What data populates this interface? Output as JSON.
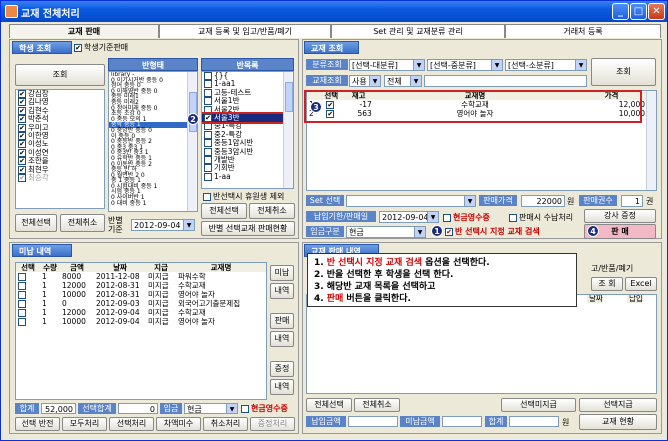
{
  "window": {
    "title": "교재 전체처리",
    "min": "_",
    "max": "□",
    "close": "✕"
  },
  "tabs": [
    {
      "label": "교재 판매",
      "active": true
    },
    {
      "label": "교재 등록 및 입고/반품/폐기"
    },
    {
      "label": "Set 관리 및 교재분류 관리"
    },
    {
      "label": "거래처 등록"
    }
  ],
  "student": {
    "header": "학생 조회",
    "base_label": "학생기준판매",
    "search_button": "조회",
    "names": [
      "강심장",
      "김나영",
      "김현수",
      "박준석",
      "우미고",
      "이한영",
      "이성노",
      "이성연",
      "조한을",
      "최현우",
      "최승각"
    ],
    "all_select": "전체선택",
    "all_cancel": "전체취소",
    "class_label1": "반별",
    "class_label2": "기준",
    "date": "2012-09-04"
  },
  "class_form": {
    "header": "반형태",
    "items": [
      "library -",
      "0 이기시거반 중등 0",
      "정어 중등 0",
      "0 이해영반 중등 0",
      "중등 미래1",
      "중등 미래2",
      "0 정어미래 중등 0",
      "초등 조강 0",
      "0 중등 모의 1",
      "중학 중등 1",
      "0 중앙반 중등 0",
      "이 중등 0",
      "0 중등반 중등 2",
      "0 중3 중3 1",
      "0 중3반 중3 1",
      "0 유학반 중등 1",
      "0 이동반 중등 2",
      "중등 반 하",
      "0 월면반 2 0",
      "중 1 중등 1",
      "0 시험대비 중등 1",
      "시험 중등 1",
      "0 사이버반 1",
      "0 대비 중등 1"
    ],
    "selected_index": 9
  },
  "class_list": {
    "header": "반목록",
    "items": [
      "{}{",
      "1-aa1",
      "고등-테스트",
      "서울1반",
      "서울2반",
      "서울3반",
      "중1-특강",
      "중2-특강",
      "중등1암시반",
      "중등3암시반",
      "개발반",
      "기회반",
      "1-aa"
    ],
    "selected_index": 5,
    "checked_index": 5,
    "rest_label": "반선택시 휴원생 제외",
    "all_select": "전체선택",
    "all_cancel": "전체취소",
    "status_button": "반별 선택교재 판매현황"
  },
  "material": {
    "header": "교재 조회",
    "category_label": "분류조회",
    "cat1": "[선택-대분류]",
    "cat2": "[선택-중분류]",
    "cat3": "[선택-소분류]",
    "search_label": "교재조회",
    "use_filter": "사용",
    "scope": "전체",
    "search_button": "조회",
    "columns": [
      "선택",
      "재고",
      "교재명",
      "가격"
    ],
    "rows": [
      {
        "no": "1",
        "checked": true,
        "stock": "-17",
        "name": "수학교재",
        "price": "12,000"
      },
      {
        "no": "2",
        "checked": true,
        "stock": "563",
        "name": "영어야 놀자",
        "price": "10,000"
      }
    ],
    "set_label": "Set 선택",
    "sale_price_label": "판매가격",
    "sale_price": "22000",
    "won": "원",
    "count_label": "판매권수",
    "count": "1",
    "count_unit": "권",
    "pay_date_label": "납입기한/판매일",
    "pay_date": "2012-09-04",
    "cash_receipt": "현금영수증",
    "unpaid_process": "판매시 수납처리",
    "lecture_gift": "강사 증정",
    "pay_type_label": "입금구분",
    "pay_type": "현금",
    "auto_check": "반 선택시 지정 교재 검색",
    "sell_button": "판 매"
  },
  "unpaid": {
    "header": "미납 내역",
    "columns": [
      "선택",
      "수량",
      "금액",
      "날짜",
      "지급",
      "교재명"
    ],
    "rows": [
      {
        "qty": "1",
        "amount": "8000",
        "date": "2011-12-08",
        "pay": "미지급",
        "name": "파워수학"
      },
      {
        "qty": "1",
        "amount": "12000",
        "date": "2012-08-31",
        "pay": "미지급",
        "name": "수학교재"
      },
      {
        "qty": "1",
        "amount": "10000",
        "date": "2012-08-31",
        "pay": "미지급",
        "name": "영어야 놀자"
      },
      {
        "qty": "1",
        "amount": "0",
        "date": "2012-09-03",
        "pay": "미지급",
        "name": "외국어고기출문제집"
      },
      {
        "qty": "1",
        "amount": "12000",
        "date": "2012-09-04",
        "pay": "미지급",
        "name": "수학교재"
      },
      {
        "qty": "1",
        "amount": "10000",
        "date": "2012-09-04",
        "pay": "미지급",
        "name": "영어야 놀자"
      }
    ],
    "side_buttons": [
      "미납",
      "내역",
      "판매",
      "내역",
      "증정",
      "내역"
    ],
    "total_label": "합계",
    "total": "52,000",
    "sel_total_label": "선택합계",
    "sel_total": "0",
    "deposit_label": "입금",
    "deposit_type": "현금",
    "cash_receipt": "현금영수증",
    "buttons": [
      "선택 반전",
      "모두처리",
      "선택처리",
      "차액미수",
      "취소처리",
      "증정처리"
    ]
  },
  "right_bottom": {
    "header": "교재 판매 내역",
    "tab_label": "고/반품/폐기",
    "search_button": "조 회",
    "excel_button": "Excel",
    "col_date": "날짜",
    "col_pay": "납입",
    "all_select": "전체선택",
    "all_cancel": "전체취소",
    "unpaid_button": "선택미지급",
    "pay_button": "선택지급",
    "pay_amount_label": "납입금액",
    "unpaid_amount_label": "미납금액",
    "sum_label": "합계",
    "won": "원",
    "status_button": "교재 현황"
  },
  "callout": {
    "lines": [
      {
        "num": "1.",
        "red": "반 선택시 지정 교재 검색",
        "rest": " 옵션을 선택한다."
      },
      {
        "num": "2.",
        "red": "",
        "rest": "반을 선택한 후 학생을 선택 한다."
      },
      {
        "num": "3.",
        "red": "",
        "rest": "해당반 교재 목록을 선택하고"
      },
      {
        "num": "4.",
        "red": "판매",
        "rest": " 버튼을 클릭한다."
      }
    ]
  },
  "markers": {
    "m1": "1",
    "m2": "2",
    "m3": "3",
    "m4": "4"
  }
}
